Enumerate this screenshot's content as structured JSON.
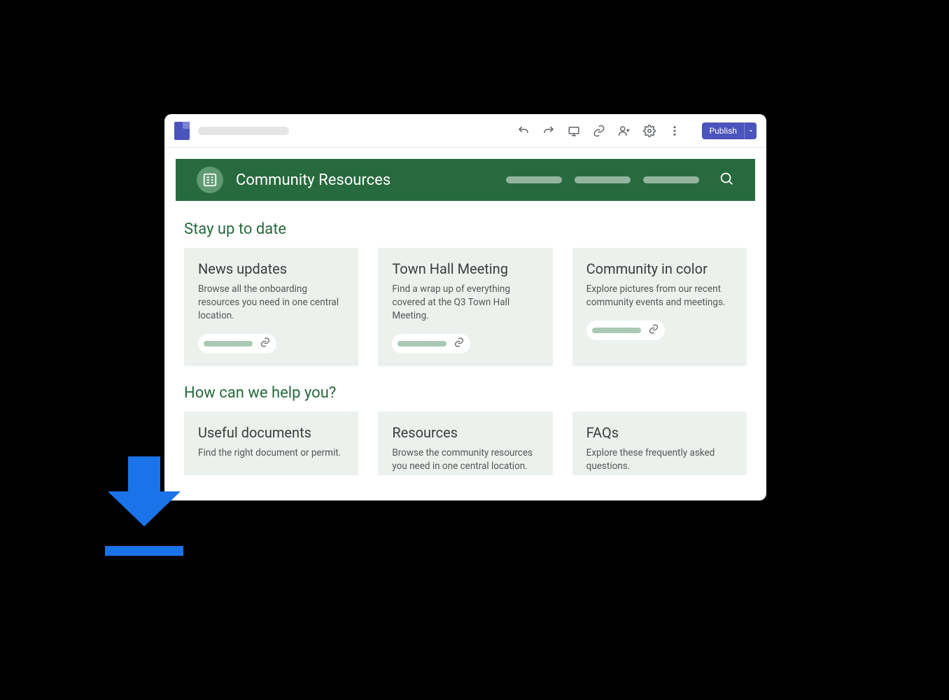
{
  "appbar": {
    "publish_label": "Publish"
  },
  "site": {
    "title": "Community Resources"
  },
  "sections": [
    {
      "title": "Stay up to date",
      "cards": [
        {
          "title": "News updates",
          "desc": "Browse all the onboarding resources you need in one central location."
        },
        {
          "title": "Town Hall Meeting",
          "desc": "Find a wrap up of everything covered at the Q3 Town Hall Meeting."
        },
        {
          "title": "Community in color",
          "desc": "Explore pictures from our recent community events and meetings."
        }
      ]
    },
    {
      "title": "How can we help you?",
      "cards": [
        {
          "title": "Useful documents",
          "desc": "Find the right document or permit."
        },
        {
          "title": "Resources",
          "desc": "Browse the community resources you need in one central location."
        },
        {
          "title": "FAQs",
          "desc": "Explore these frequently asked questions."
        }
      ]
    }
  ]
}
